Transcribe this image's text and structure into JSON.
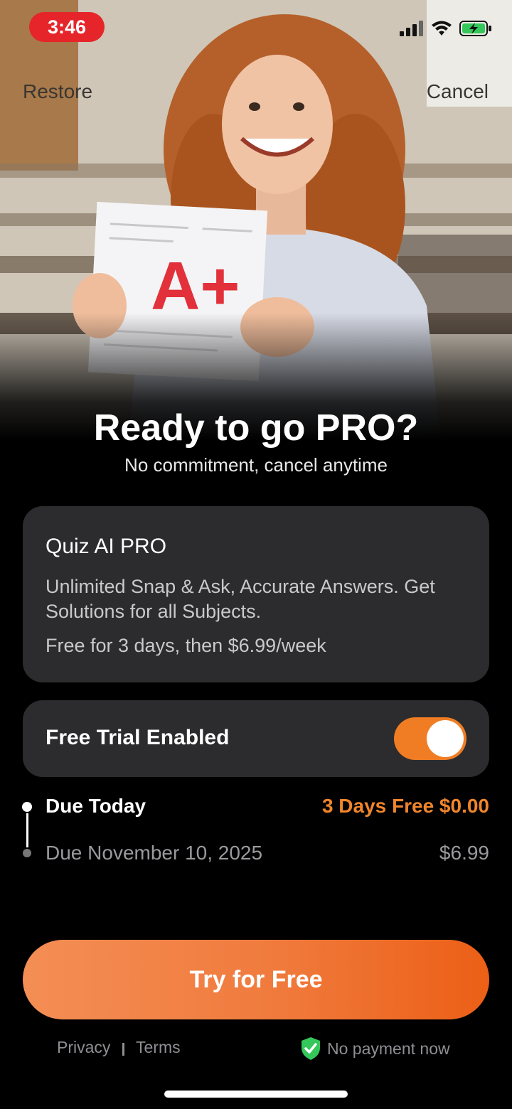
{
  "status_bar": {
    "time": "3:46"
  },
  "nav": {
    "restore_label": "Restore",
    "cancel_label": "Cancel"
  },
  "hero": {
    "paper_grade": "A+"
  },
  "headline": "Ready to go PRO?",
  "subhead": "No commitment, cancel anytime",
  "plan": {
    "title": "Quiz AI PRO",
    "description": "Unlimited Snap & Ask, Accurate Answers. Get Solutions for all Subjects.",
    "price_text": "Free for 3 days, then $6.99/week"
  },
  "trial": {
    "label": "Free Trial Enabled",
    "enabled": true
  },
  "timeline": {
    "today_label": "Due Today",
    "today_value": "3 Days Free $0.00",
    "later_label": "Due November 10, 2025",
    "later_value": "$6.99"
  },
  "cta_label": "Try for Free",
  "footer": {
    "privacy_label": "Privacy",
    "terms_label": "Terms",
    "no_payment_label": "No payment now"
  },
  "colors": {
    "accent": "#f07d23",
    "time_pill": "#e5252a",
    "card_bg": "#2c2c2e",
    "shield_green": "#34c759"
  }
}
